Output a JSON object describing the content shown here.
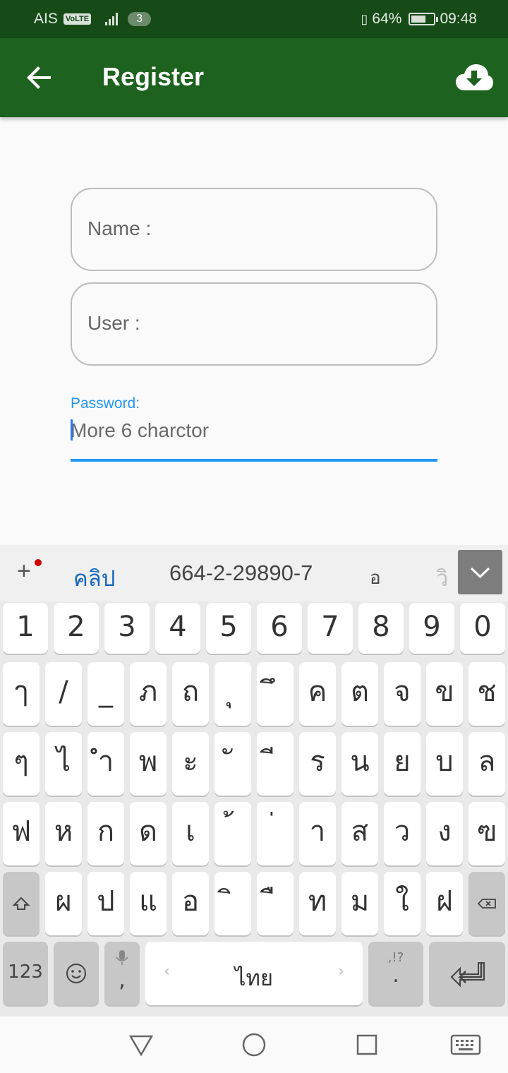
{
  "status_bar": {
    "carrier": "AIS",
    "volte": "VoLTE",
    "sim": "3",
    "battery": "64%",
    "time": "09:48",
    "battery_level": 64
  },
  "app_bar": {
    "title": "Register",
    "back_icon": "arrow-left-icon",
    "action_icon": "cloud-download-icon"
  },
  "form": {
    "name_placeholder": "Name :",
    "user_placeholder": "User :",
    "password_label": "Password:",
    "password_placeholder": "More 6 charctor"
  },
  "keyboard": {
    "suggestions": [
      "คลิป",
      "664-2-29890-7",
      "อ",
      "วิ"
    ],
    "row_numbers": [
      "1",
      "2",
      "3",
      "4",
      "5",
      "6",
      "7",
      "8",
      "9",
      "0"
    ],
    "row1": [
      "ๅ",
      "/",
      "_",
      "ภ",
      "ถ",
      "ุ",
      "ึ",
      "ค",
      "ต",
      "จ",
      "ข",
      "ช"
    ],
    "row2": [
      "ๆ",
      "ไ",
      "ำ",
      "พ",
      "ะ",
      "ั",
      "ี",
      "ร",
      "น",
      "ย",
      "บ",
      "ล"
    ],
    "row3": [
      "ฟ",
      "ห",
      "ก",
      "ด",
      "เ",
      "้",
      "่",
      "า",
      "ส",
      "ว",
      "ง",
      "ฃ"
    ],
    "row4": [
      "ผ",
      "ป",
      "แ",
      "อ",
      "ิ",
      "ื",
      "ท",
      "ม",
      "ใ",
      "ฝ"
    ],
    "bottom": {
      "symbols": "123",
      "comma": ",",
      "space": "ไทย",
      "period": ".",
      "punct_hint": ",!?"
    }
  },
  "colors": {
    "status_bar": "#164a17",
    "app_bar": "#1e621f",
    "accent": "#2196f3"
  }
}
